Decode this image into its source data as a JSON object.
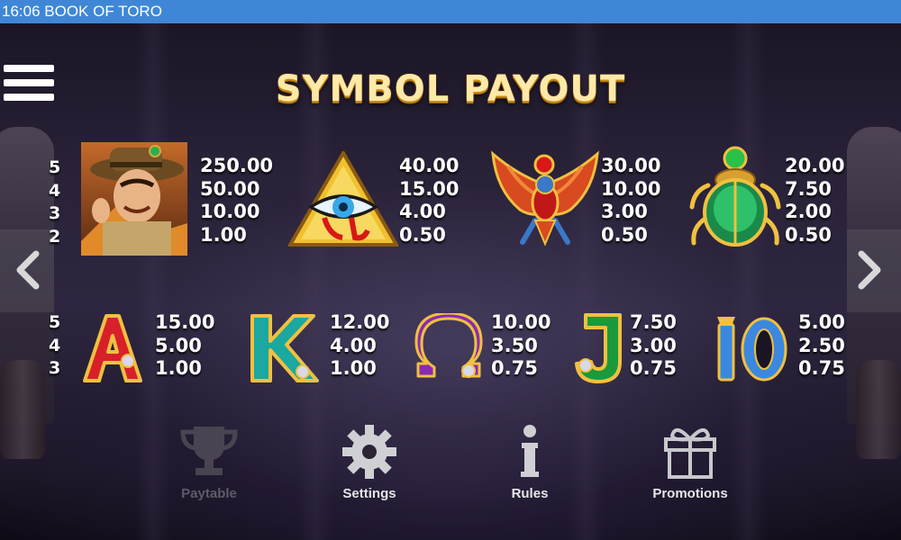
{
  "status_bar": {
    "time": "16:06",
    "title": "BOOK OF TORO",
    "text": "16:06 BOOK OF TORO"
  },
  "screen": {
    "heading": "SYMBOL PAYOUT"
  },
  "menu": {
    "icon": "hamburger-menu-icon"
  },
  "navigation": {
    "prev_icon": "chevron-left-icon",
    "next_icon": "chevron-right-icon"
  },
  "colors": {
    "status_bar": "#3f87d6",
    "heading_gold": "#ffe9a8",
    "disabled_nav": "#5f5a66"
  },
  "high_symbols": {
    "counts": [
      "5",
      "4",
      "3",
      "2"
    ],
    "items": [
      {
        "symbol": "explorer",
        "payouts": [
          "250.00",
          "50.00",
          "10.00",
          "1.00"
        ]
      },
      {
        "symbol": "eye-of-horus-pyramid",
        "payouts": [
          "40.00",
          "15.00",
          "4.00",
          "0.50"
        ]
      },
      {
        "symbol": "winged-falcon",
        "payouts": [
          "30.00",
          "10.00",
          "3.00",
          "0.50"
        ]
      },
      {
        "symbol": "green-scarab",
        "payouts": [
          "20.00",
          "7.50",
          "2.00",
          "0.50"
        ]
      }
    ]
  },
  "low_symbols": {
    "counts": [
      "5",
      "4",
      "3"
    ],
    "items": [
      {
        "symbol": "A",
        "payouts": [
          "15.00",
          "5.00",
          "1.00"
        ]
      },
      {
        "symbol": "K",
        "payouts": [
          "12.00",
          "4.00",
          "1.00"
        ]
      },
      {
        "symbol": "Q",
        "payouts": [
          "10.00",
          "3.50",
          "0.75"
        ]
      },
      {
        "symbol": "J",
        "payouts": [
          "7.50",
          "3.00",
          "0.75"
        ]
      },
      {
        "symbol": "10",
        "payouts": [
          "5.00",
          "2.50",
          "0.75"
        ]
      }
    ]
  },
  "bottom_nav": [
    {
      "label": "Paytable",
      "icon": "trophy-icon",
      "state": "active-disabled"
    },
    {
      "label": "Settings",
      "icon": "gear-icon"
    },
    {
      "label": "Rules",
      "icon": "info-icon"
    },
    {
      "label": "Promotions",
      "icon": "gift-icon"
    }
  ]
}
